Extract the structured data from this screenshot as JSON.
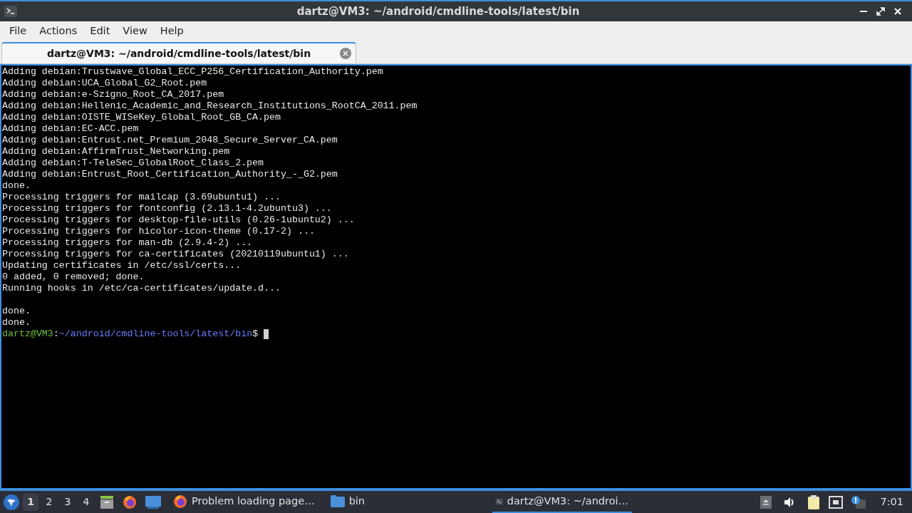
{
  "window": {
    "title": "dartz@VM3: ~/android/cmdline-tools/latest/bin"
  },
  "menu": [
    "File",
    "Actions",
    "Edit",
    "View",
    "Help"
  ],
  "tabs": [
    {
      "label": "dartz@VM3: ~/android/cmdline-tools/latest/bin",
      "selected": true
    }
  ],
  "terminal": {
    "lines": [
      {
        "kind": "text",
        "text": "Adding debian:Trustwave_Global_ECC_P256_Certification_Authority.pem"
      },
      {
        "kind": "text",
        "text": "Adding debian:UCA_Global_G2_Root.pem"
      },
      {
        "kind": "text",
        "text": "Adding debian:e-Szigno_Root_CA_2017.pem"
      },
      {
        "kind": "text",
        "text": "Adding debian:Hellenic_Academic_and_Research_Institutions_RootCA_2011.pem"
      },
      {
        "kind": "text",
        "text": "Adding debian:OISTE_WISeKey_Global_Root_GB_CA.pem"
      },
      {
        "kind": "text",
        "text": "Adding debian:EC-ACC.pem"
      },
      {
        "kind": "text",
        "text": "Adding debian:Entrust.net_Premium_2048_Secure_Server_CA.pem"
      },
      {
        "kind": "text",
        "text": "Adding debian:AffirmTrust_Networking.pem"
      },
      {
        "kind": "text",
        "text": "Adding debian:T-TeleSec_GlobalRoot_Class_2.pem"
      },
      {
        "kind": "text",
        "text": "Adding debian:Entrust_Root_Certification_Authority_-_G2.pem"
      },
      {
        "kind": "text",
        "text": "done."
      },
      {
        "kind": "text",
        "text": "Processing triggers for mailcap (3.69ubuntu1) ..."
      },
      {
        "kind": "text",
        "text": "Processing triggers for fontconfig (2.13.1-4.2ubuntu3) ..."
      },
      {
        "kind": "text",
        "text": "Processing triggers for desktop-file-utils (0.26-1ubuntu2) ..."
      },
      {
        "kind": "text",
        "text": "Processing triggers for hicolor-icon-theme (0.17-2) ..."
      },
      {
        "kind": "text",
        "text": "Processing triggers for man-db (2.9.4-2) ..."
      },
      {
        "kind": "text",
        "text": "Processing triggers for ca-certificates (20210119ubuntu1) ..."
      },
      {
        "kind": "text",
        "text": "Updating certificates in /etc/ssl/certs..."
      },
      {
        "kind": "text",
        "text": "0 added, 0 removed; done."
      },
      {
        "kind": "text",
        "text": "Running hooks in /etc/ca-certificates/update.d..."
      },
      {
        "kind": "blank"
      },
      {
        "kind": "text",
        "text": "done."
      },
      {
        "kind": "text",
        "text": "done."
      }
    ],
    "prompt": {
      "user_host": "dartz@VM3",
      "separator": ":",
      "path": "~/android/cmdline-tools/latest/bin",
      "symbol": "$"
    }
  },
  "taskbar": {
    "workspaces": [
      {
        "label": "1",
        "selected": true
      },
      {
        "label": "2",
        "selected": false
      },
      {
        "label": "3",
        "selected": false
      },
      {
        "label": "4",
        "selected": false
      }
    ],
    "tasks": [
      {
        "kind": "browser",
        "label": "Problem loading page…",
        "selected": false
      },
      {
        "kind": "folder",
        "label": "bin",
        "selected": false
      },
      {
        "kind": "terminal",
        "label": "dartz@VM3: ~/androi…",
        "selected": true
      }
    ],
    "clock": "7:01"
  }
}
